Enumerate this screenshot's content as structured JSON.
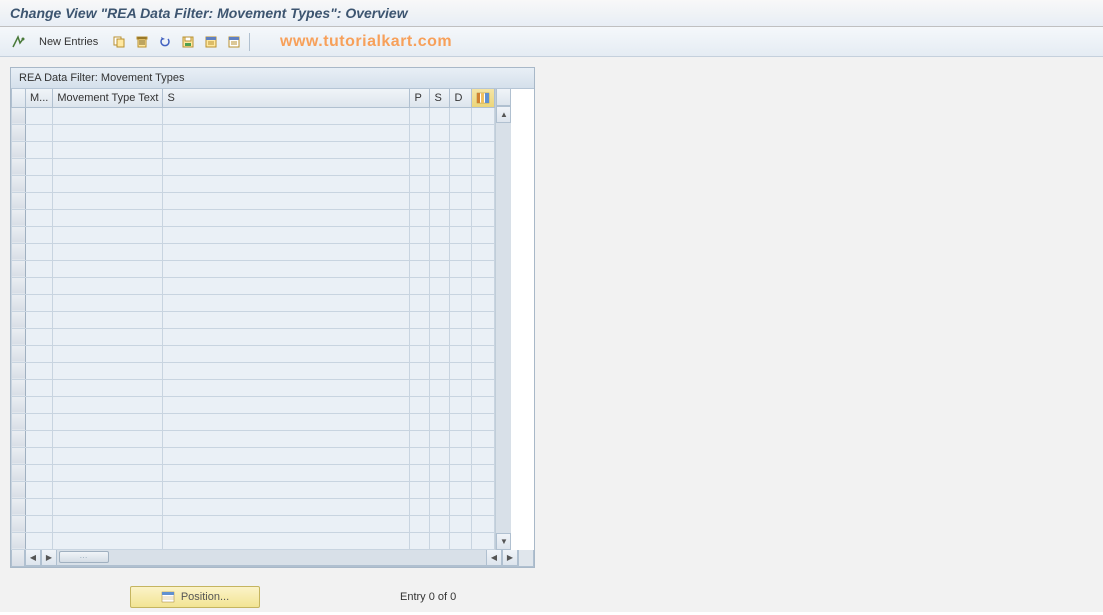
{
  "title": "Change View \"REA Data Filter: Movement Types\": Overview",
  "toolbar": {
    "new_entries": "New Entries"
  },
  "watermark": "www.tutorialkart.com",
  "panel": {
    "title": "REA Data Filter: Movement Types"
  },
  "columns": {
    "m": "M...",
    "mvtext": "Movement Type Text",
    "s": "S",
    "p": "P",
    "s2": "S",
    "d": "D"
  },
  "footer": {
    "position_label": "Position...",
    "entry_text": "Entry 0 of 0"
  },
  "row_count": 26
}
